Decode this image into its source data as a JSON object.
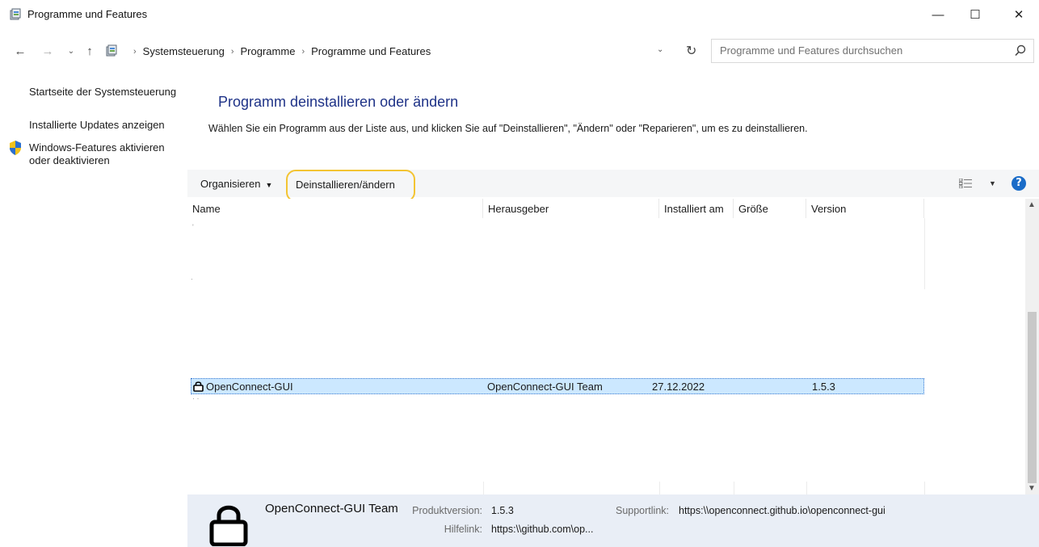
{
  "window": {
    "title": "Programme und Features",
    "minimize": "—",
    "maximize": "☐",
    "close": "✕"
  },
  "address": {
    "crumbs": [
      "Systemsteuerung",
      "Programme",
      "Programme und Features"
    ],
    "search_placeholder": "Programme und Features durchsuchen"
  },
  "sidebar": {
    "items": [
      {
        "label": "Startseite der Systemsteuerung"
      },
      {
        "label": "Installierte Updates anzeigen"
      },
      {
        "label": "Windows-Features aktivieren oder deaktivieren"
      }
    ]
  },
  "main": {
    "heading": "Programm deinstallieren oder ändern",
    "instruction": "Wählen Sie ein Programm aus der Liste aus, und klicken Sie auf \"Deinstallieren\", \"Ändern\" oder \"Reparieren\", um es zu deinstallieren."
  },
  "toolbar": {
    "organize_label": "Organisieren",
    "uninstall_label": "Deinstallieren/ändern",
    "help_label": "?"
  },
  "list": {
    "columns": [
      "Name",
      "Herausgeber",
      "Installiert am",
      "Größe",
      "Version"
    ],
    "selected_row": {
      "name": "OpenConnect-GUI",
      "publisher": "OpenConnect-GUI Team",
      "installed": "27.12.2022",
      "size": "",
      "version": "1.5.3"
    }
  },
  "details": {
    "name": "OpenConnect-GUI Team",
    "product_version_label": "Produktversion:",
    "product_version": "1.5.3",
    "support_link_label": "Supportlink:",
    "support_link": "https:\\\\openconnect.github.io\\openconnect-gui",
    "help_link_label": "Hilfelink:",
    "help_link": "https:\\\\github.com\\op..."
  },
  "colors": {
    "heading": "#1e3287",
    "selection": "#cce8ff",
    "highlight_outline": "#f3c432",
    "details_bg": "#e9eef6",
    "help_icon": "#1a6cc8"
  }
}
